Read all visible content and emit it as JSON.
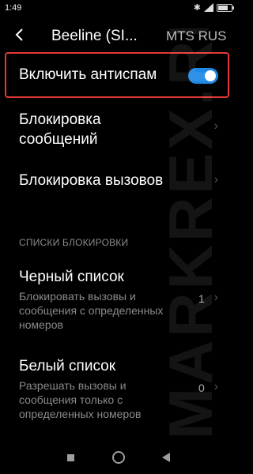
{
  "status_bar": {
    "time": "1:49",
    "bluetooth_icon": "bluetooth-icon",
    "signal_icon": "signal-icon",
    "battery_icon": "battery-icon"
  },
  "header": {
    "back_icon": "chevron-left-icon",
    "tabs": [
      {
        "label": "Beeline (SI...",
        "active": true
      },
      {
        "label": "MTS RUS",
        "active": false
      }
    ]
  },
  "antispam": {
    "label": "Включить антиспам",
    "enabled": true,
    "accent": "#1e88e5",
    "highlight_color": "#e53935"
  },
  "items": [
    {
      "title": "Блокировка\nсообщений"
    },
    {
      "title": "Блокировка вызовов"
    }
  ],
  "section_header": "СПИСКИ БЛОКИРОВКИ",
  "lists": [
    {
      "title": "Черный список",
      "subtitle": "Блокировать вызовы и сообщения с определенных номеров",
      "count": "1"
    },
    {
      "title": "Белый список",
      "subtitle": "Разрешать вызовы и сообщения только с определенных номеров",
      "count": "0"
    }
  ],
  "watermark": "MARKREX.RU",
  "navbar": {
    "recent_icon": "square-icon",
    "home_icon": "circle-icon",
    "back_icon": "triangle-back-icon"
  }
}
